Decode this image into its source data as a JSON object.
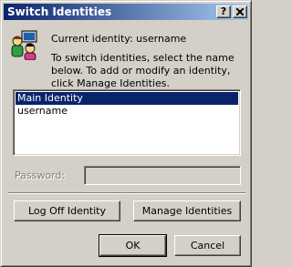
{
  "window": {
    "title": "Switch Identities",
    "help_label": "?",
    "close_label": "x"
  },
  "header": {
    "icon": "identities-people-icon",
    "current_identity": "Current identity: username",
    "instructions": "To switch identities, select the name below. To add or modify an identity, click Manage Identities."
  },
  "identities": {
    "items": [
      {
        "label": "Main Identity",
        "selected": true
      },
      {
        "label": "username",
        "selected": false
      }
    ]
  },
  "password": {
    "label": "Password:",
    "value": ""
  },
  "actions": {
    "log_off_label": "Log Off Identity",
    "manage_label": "Manage Identities",
    "ok_label": "OK",
    "cancel_label": "Cancel"
  },
  "colors": {
    "title_gradient_start": "#0a246a",
    "title_gradient_end": "#a6caf0",
    "selection": "#0a246a",
    "face": "#d4d0c8"
  }
}
